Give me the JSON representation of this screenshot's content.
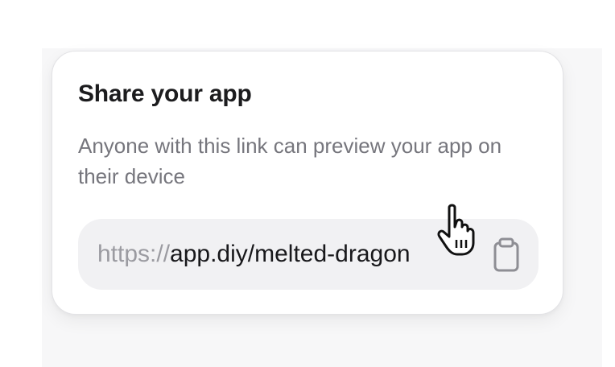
{
  "share": {
    "title": "Share your app",
    "description": "Anyone with this link can preview your app on their device",
    "link_prefix": "https://",
    "link_path": "app.diy/melted-dragon"
  },
  "icons": {
    "copy": "clipboard-icon",
    "cursor": "pointer-hand-cursor-icon"
  },
  "colors": {
    "title": "#1c1c1e",
    "description": "#76767d",
    "field_background": "#f1f1f3",
    "link_prefix": "#9b9ba1",
    "link_path": "#18181b"
  }
}
